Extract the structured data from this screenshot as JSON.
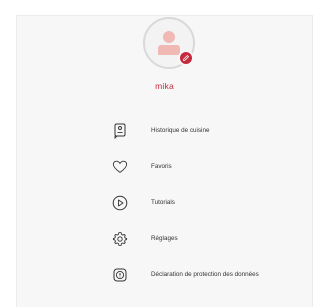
{
  "profile": {
    "username": "mika",
    "accent_color": "#c72a3c"
  },
  "menu": {
    "items": [
      {
        "label": "Historique de cuisine",
        "icon": "cooking-history-icon"
      },
      {
        "label": "Favoris",
        "icon": "heart-icon"
      },
      {
        "label": "Tutorials",
        "icon": "play-icon"
      },
      {
        "label": "Réglages",
        "icon": "gear-icon"
      },
      {
        "label": "Déclaration de protection des données",
        "icon": "privacy-icon"
      }
    ]
  }
}
